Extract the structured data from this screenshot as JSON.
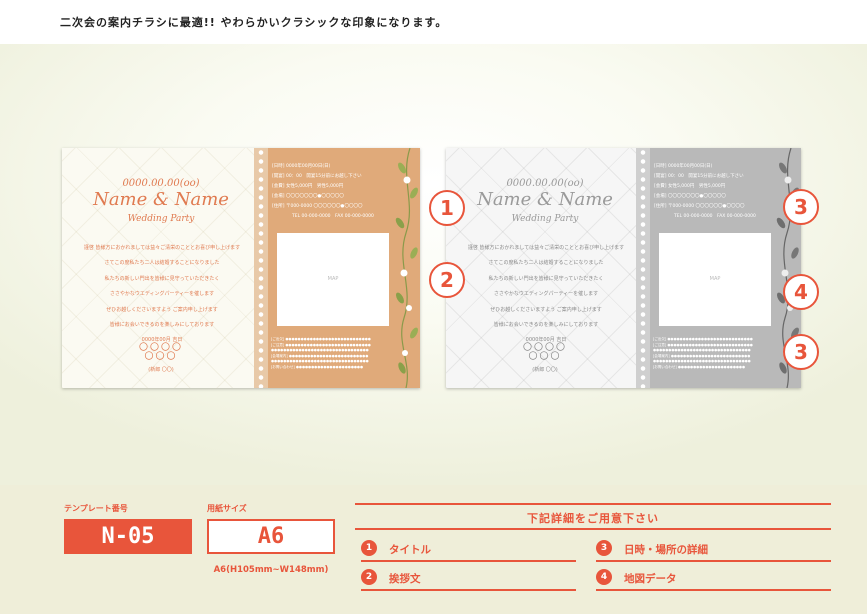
{
  "headline": "二次会の案内チラシに最適!! やわらかいクラシックな印象になります。",
  "flyer": {
    "date": "0000.00.00(oo)",
    "names": "Name & Name",
    "party": "Wedding Party",
    "greeting": [
      "謹啓 皆様方におかれましては益々ご清栄のこととお喜び申し上げます",
      "さてこの度私たち二人は結婚することになりました",
      "私たちの新しい門出を皆様に見守っていただきたく",
      "ささやかなウエディングパーティーを催します",
      "ぜひお越しくださいますよう ご案内申し上げます",
      "皆様にお会いできるのを楽しみにしております"
    ],
    "sign_date": "0000年00月 吉日",
    "circles_row1": "〇〇〇〇",
    "circles_row2": "〇〇〇",
    "signature": "(新郎 〇〇)",
    "info": [
      {
        "label": "[日時]",
        "value": "0000年00月00日(日)"
      },
      {
        "label": "[開宴]",
        "value": "00：00　開宴15分前にお越し下さい"
      },
      {
        "label": "[会費]",
        "value": "女性5,000円　男性5,000円"
      },
      {
        "label": "[会場]",
        "value": "〇〇〇〇〇〇〇●〇〇〇〇〇"
      },
      {
        "label": "[住所]",
        "value": "〒000-0000 〇〇〇〇〇〇●〇〇〇〇"
      }
    ],
    "phone": "TEL 00-000-0000　FAX 00-000-0000",
    "map_label": "MAP",
    "footer": [
      "[ご出欠] ●●●●●●●●●●●●●●●●●●●●●●●●●●●●",
      "[ご注意] ●●●●●●●●●●●●●●●●●●●●●●●●●●●●",
      "●●●●●●●●●●●●●●●●●●●●●●●●●●●●●●●●",
      "[会場案内] ●●●●●●●●●●●●●●●●●●●●●●●●●●",
      "●●●●●●●●●●●●●●●●●●●●●●●●●●●●●●●●",
      "[お問い合わせ] ●●●●●●●●●●●●●●●●●●●●●●"
    ]
  },
  "markers": {
    "m1": "1",
    "m2": "2",
    "m3a": "3",
    "m4": "4",
    "m3b": "3"
  },
  "template": {
    "label": "テンプレート番号",
    "code": "N-05"
  },
  "paper": {
    "label": "用紙サイズ",
    "size": "A6",
    "detail": "A6(H105mm~W148mm)"
  },
  "details": {
    "title": "下記詳細をご用意下さい",
    "items": [
      {
        "num": "1",
        "text": "タイトル"
      },
      {
        "num": "2",
        "text": "挨拶文"
      },
      {
        "num": "3",
        "text": "日時・場所の詳細"
      },
      {
        "num": "4",
        "text": "地図データ"
      }
    ]
  },
  "colors": {
    "accent": "#e8553b",
    "panel": "#e0aa7a",
    "gray_panel": "#b9b9b9"
  }
}
